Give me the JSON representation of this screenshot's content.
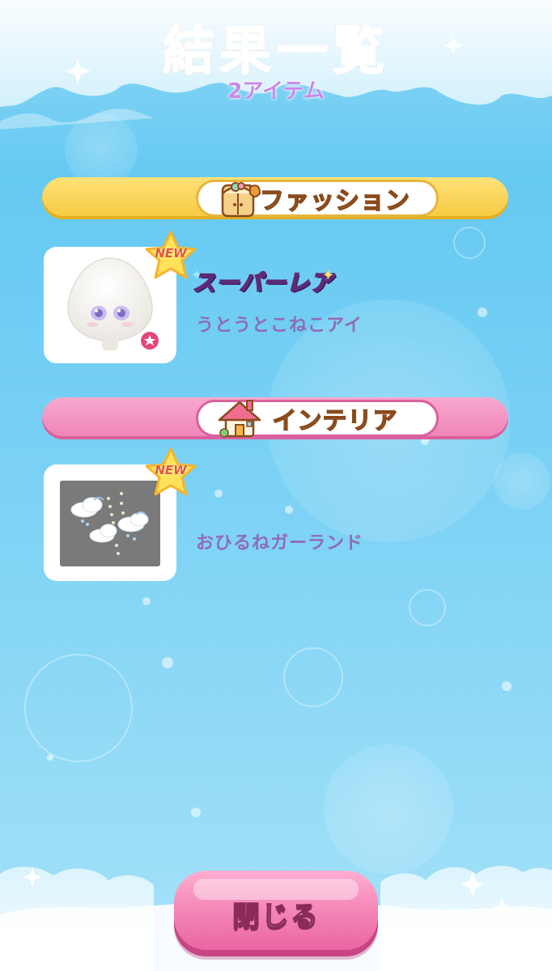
{
  "header": {
    "title": "結果一覧",
    "item_count": "2アイテム"
  },
  "sections": [
    {
      "label": "ファッション",
      "icon": "wardrobe-icon",
      "color": "#f6c93d",
      "items": [
        {
          "badge": "NEW",
          "rarity": "スーパーレア",
          "name": "うとうとこねこアイ",
          "icon": "cat-eyes-icon"
        }
      ]
    },
    {
      "label": "インテリア",
      "icon": "house-icon",
      "color": "#ee82b6",
      "items": [
        {
          "badge": "NEW",
          "name": "おひるねガーランド",
          "icon": "cloud-garland-icon"
        }
      ]
    }
  ],
  "footer": {
    "close_label": "閉じる"
  }
}
